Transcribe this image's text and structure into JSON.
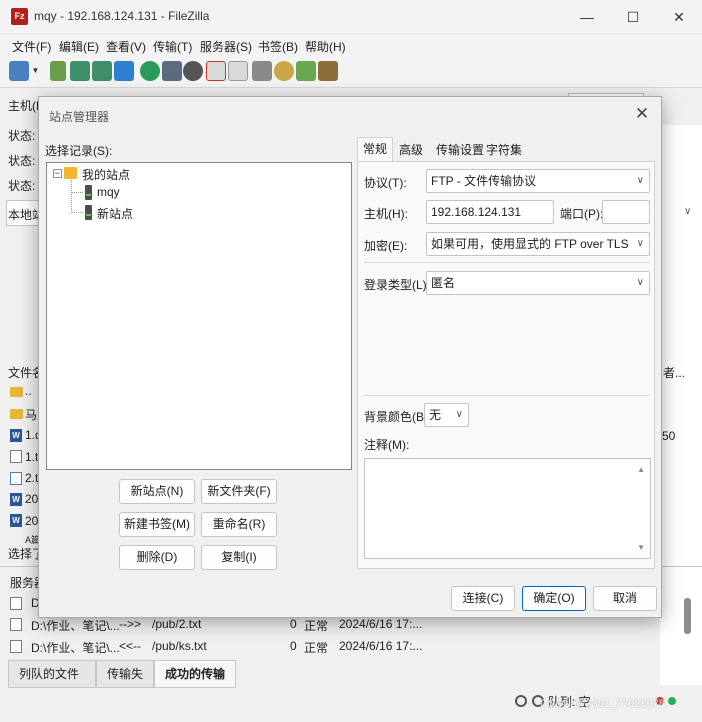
{
  "window": {
    "app_icon_text": "Fz",
    "title": "mqy - 192.168.124.131 - FileZilla",
    "minimize": "—",
    "maximize": "☐",
    "close": "✕"
  },
  "menu": [
    "文件(F)",
    "编辑(E)",
    "查看(V)",
    "传输(T)",
    "服务器(S)",
    "书签(B)",
    "帮助(H)"
  ],
  "background": {
    "host_label_partial": "主机(H",
    "status_lines": [
      "状态: E",
      "状态: 开",
      "状态: 文"
    ],
    "local_site_partial": "本地站",
    "file_name_header_partial": "文件名",
    "owner_header_partial": "者...",
    "number_partial": "50",
    "local_files": [
      "..",
      "马点",
      "1.d",
      "1.tx",
      "2.tx",
      "20.",
      "202",
      "A篇"
    ],
    "selected_partial": "选择了",
    "server_header_partial": "服务器",
    "queue": [
      {
        "local": "D:",
        "dir": "",
        "remote": "",
        "size": "",
        "prio": "",
        "time": ""
      },
      {
        "local": "D:\\作业、笔记\\...",
        "dir": "-->>",
        "remote": "/pub/2.txt",
        "size": "0",
        "prio": "正常",
        "time": "2024/6/16 17:..."
      },
      {
        "local": "D:\\作业、笔记\\...",
        "dir": "<<--",
        "remote": "/pub/ks.txt",
        "size": "0",
        "prio": "正常",
        "time": "2024/6/16 17:..."
      }
    ],
    "bottom_tabs": [
      "列队的文件",
      "传输失败",
      "成功的传输 (3)"
    ],
    "queue_status": "队列: 空",
    "watermark": "CSDN @2301_77028678"
  },
  "dialog": {
    "title": "站点管理器",
    "close": "✕",
    "select_entry_label": "选择记录(S):",
    "tree": {
      "root_expand": "−",
      "root": "我的站点",
      "children": [
        "mqy",
        "新站点"
      ]
    },
    "buttons": {
      "new_site": "新站点(N)",
      "new_folder": "新文件夹(F)",
      "new_bookmark": "新建书签(M)",
      "rename": "重命名(R)",
      "delete": "删除(D)",
      "copy": "复制(I)",
      "connect": "连接(C)",
      "ok": "确定(O)",
      "cancel": "取消"
    },
    "tabs": [
      "常规",
      "高级",
      "传输设置",
      "字符集"
    ],
    "general": {
      "protocol_label": "协议(T):",
      "protocol_value": "FTP - 文件传输协议",
      "host_label": "主机(H):",
      "host_value": "192.168.124.131",
      "port_label": "端口(P):",
      "port_value": "",
      "encryption_label": "加密(E):",
      "encryption_value": "如果可用，使用显式的 FTP over TLS",
      "logon_type_label": "登录类型(L):",
      "logon_type_value": "匿名",
      "bg_color_label": "背景颜色(B)",
      "bg_color_value": "无",
      "comments_label": "注释(M):",
      "comments_value": ""
    }
  }
}
